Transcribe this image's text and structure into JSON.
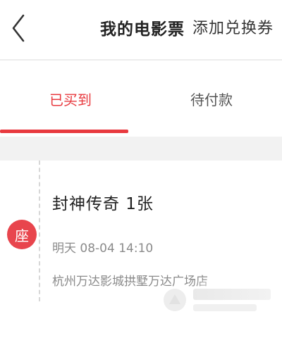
{
  "navbar": {
    "back_icon": "chevron-left-icon",
    "title": "我的电影票",
    "action_label": "添加兑换券"
  },
  "tabs": [
    {
      "label": "已买到",
      "active": true
    },
    {
      "label": "待付款",
      "active": false
    }
  ],
  "ticket": {
    "badge_text": "座",
    "title": "封神传奇 1张",
    "time": "明天 08-04 14:10",
    "cinema": "杭州万达影城拱墅万达广场店"
  },
  "colors": {
    "accent": "#e83a3f",
    "badge": "#e8454d",
    "muted_text": "#8a8a8a",
    "band": "#f2f2f2"
  }
}
